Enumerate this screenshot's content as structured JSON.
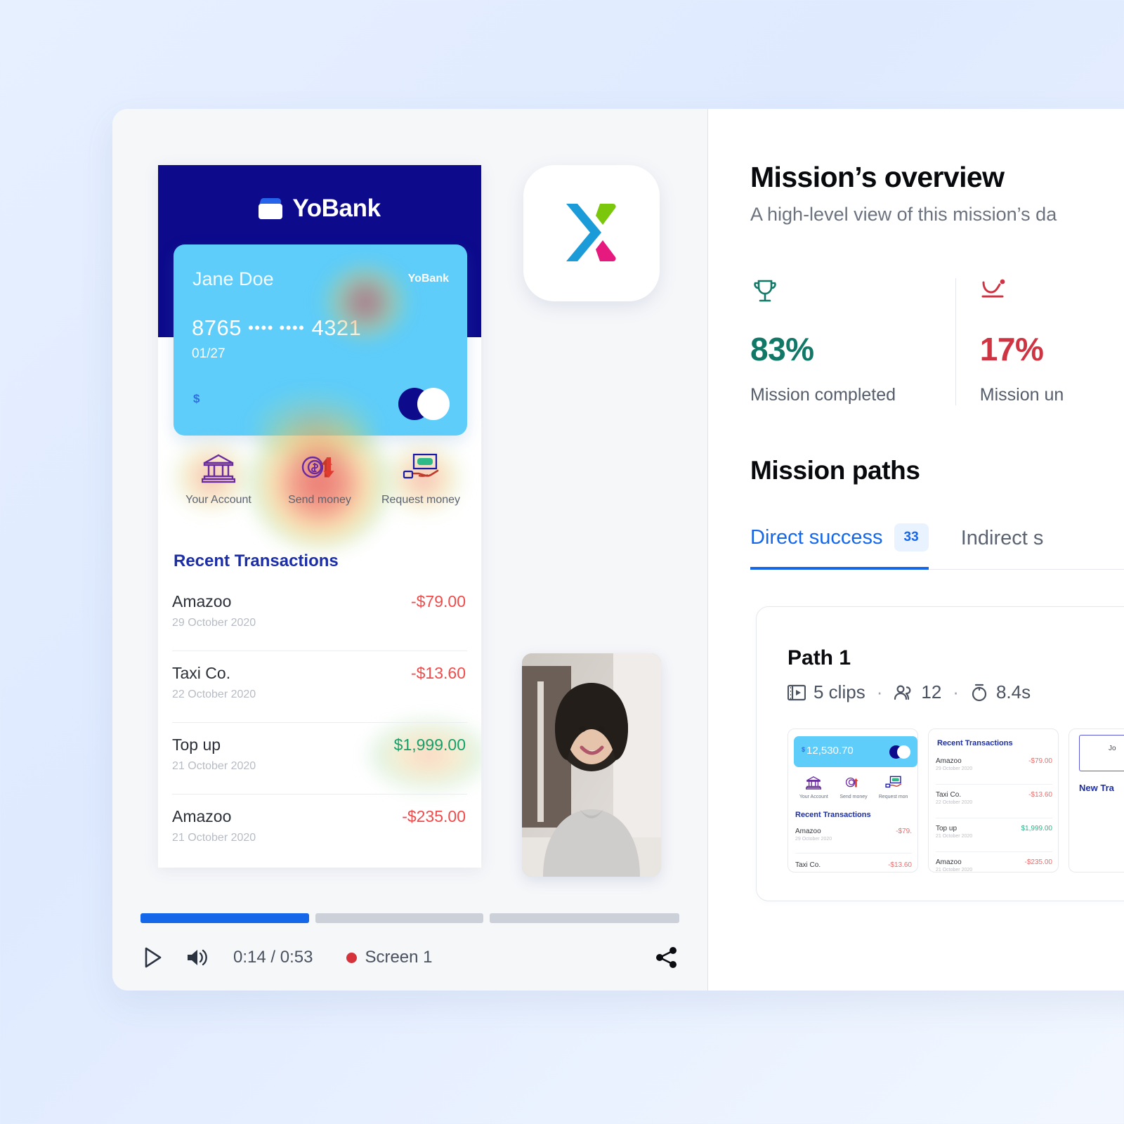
{
  "player": {
    "app_logo_name": "x-app-logo",
    "phone": {
      "brand": "YoBank",
      "card": {
        "holder": "Jane Doe",
        "bank_label": "YoBank",
        "number_prefix": "8765",
        "number_masked": "•••• ••••",
        "number_suffix": "4321",
        "expiry": "01/27",
        "currency_symbol": "$"
      },
      "actions": [
        {
          "label": "Your Account",
          "icon": "bank-icon"
        },
        {
          "label": "Send money",
          "icon": "send-money-icon"
        },
        {
          "label": "Request money",
          "icon": "request-money-icon"
        }
      ],
      "transactions_title": "Recent Transactions",
      "transactions": [
        {
          "name": "Amazoo",
          "date": "29 October 2020",
          "amount": "-$79.00",
          "sign": "neg"
        },
        {
          "name": "Taxi Co.",
          "date": "22 October 2020",
          "amount": "-$13.60",
          "sign": "neg"
        },
        {
          "name": "Top up",
          "date": "21 October 2020",
          "amount": "$1,999.00",
          "sign": "pos"
        },
        {
          "name": "Amazoo",
          "date": "21 October 2020",
          "amount": "-$235.00",
          "sign": "neg"
        }
      ]
    },
    "controls": {
      "play_label": "play-icon",
      "volume_label": "volume-icon",
      "time": "0:14 / 0:53",
      "screen": "Screen 1",
      "share_label": "share-icon"
    },
    "timeline": {
      "segments": [
        {
          "width_pct": 32,
          "fill_pct": 100
        },
        {
          "width_pct": 32,
          "fill_pct": 0
        },
        {
          "width_pct": 36,
          "fill_pct": 0
        }
      ]
    }
  },
  "insights": {
    "title": "Mission’s overview",
    "subtitle": "A high-level view of this mission’s da",
    "stats": [
      {
        "icon": "trophy-icon",
        "value": "83%",
        "caption": "Mission completed",
        "tone": "ok",
        "color": "#117867"
      },
      {
        "icon": "bounce-icon",
        "value": "17%",
        "caption": "Mission un",
        "tone": "bad",
        "color": "#cf3443"
      }
    ],
    "paths_title": "Mission paths",
    "tabs": [
      {
        "label": "Direct success",
        "badge": "33",
        "active": true
      },
      {
        "label": "Indirect s",
        "badge": "",
        "active": false
      }
    ],
    "path_card": {
      "title": "Path 1",
      "clips": "5 clips",
      "viewers": "12",
      "duration": "8.4s",
      "clips_icon": "film-icon",
      "viewers_icon": "people-icon",
      "duration_icon": "timer-icon",
      "thumbnails": [
        {
          "balance": "12,530.70",
          "currency": "$",
          "actions": [
            "Your Account",
            "Send money",
            "Request mon"
          ],
          "tx_title": "Recent Transactions",
          "rows": [
            {
              "name": "Amazoo",
              "date": "29 October 2020",
              "amount": "-$79.",
              "sign": "neg"
            },
            {
              "name": "Taxi Co.",
              "date": "",
              "amount": "-$13.60",
              "sign": "neg"
            }
          ]
        },
        {
          "tx_title": "Recent Transactions",
          "rows": [
            {
              "name": "Amazoo",
              "date": "29 October 2020",
              "amount": "-$79.00",
              "sign": "neg"
            },
            {
              "name": "Taxi Co.",
              "date": "22 October 2020",
              "amount": "-$13.60",
              "sign": "neg"
            },
            {
              "name": "Top up",
              "date": "21 October 2020",
              "amount": "$1,999.00",
              "sign": "pos"
            },
            {
              "name": "Amazoo",
              "date": "21 October 2020",
              "amount": "-$235.00",
              "sign": "neg"
            }
          ]
        },
        {
          "field_value": "Jo",
          "label": "New Tra"
        }
      ]
    }
  }
}
